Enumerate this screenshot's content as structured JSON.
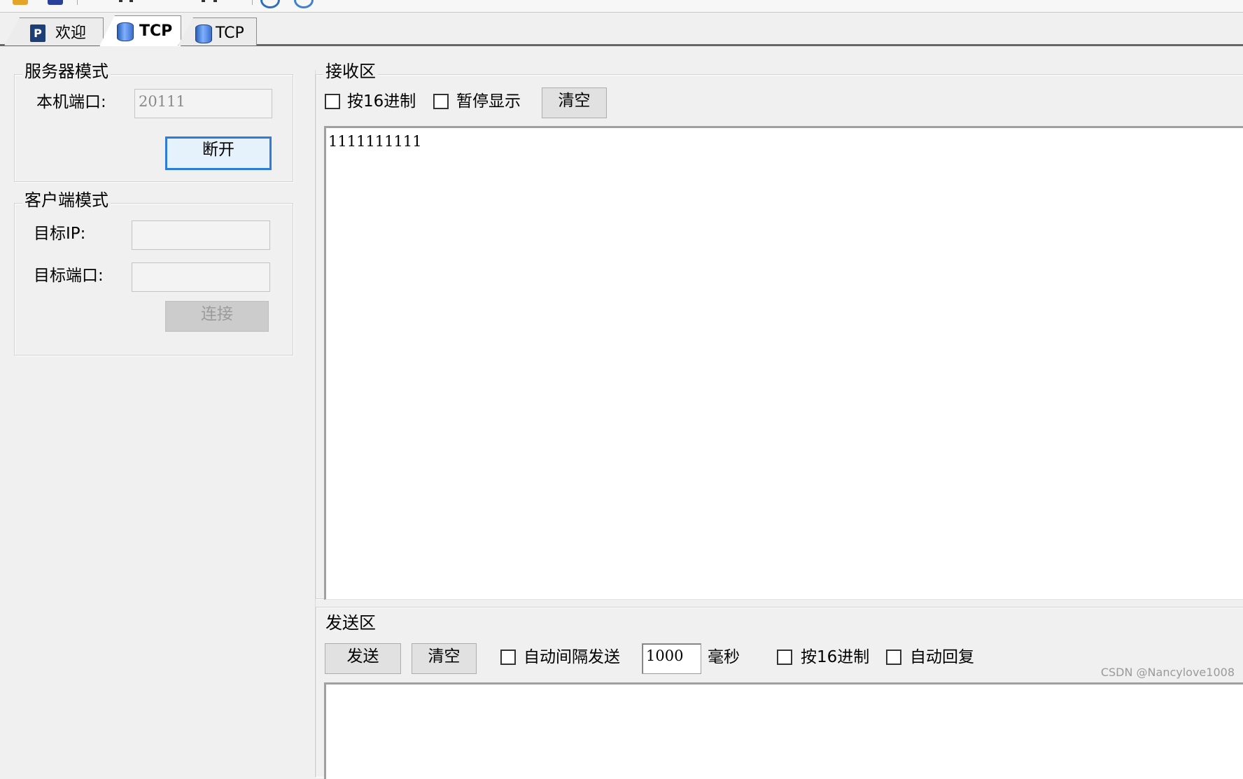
{
  "tabs": [
    {
      "label": "欢迎",
      "icon": "welcome-icon"
    },
    {
      "label": "TCP",
      "icon": "database-icon",
      "active": true
    },
    {
      "label": "TCP",
      "icon": "database-icon"
    }
  ],
  "server_mode": {
    "title": "服务器模式",
    "local_port_label": "本机端口:",
    "local_port_value": "20111",
    "disconnect_label": "断开"
  },
  "client_mode": {
    "title": "客户端模式",
    "target_ip_label": "目标IP:",
    "target_ip_value": "",
    "target_port_label": "目标端口:",
    "target_port_value": "",
    "connect_label": "连接"
  },
  "receive_area": {
    "title": "接收区",
    "hex_label": "按16进制",
    "pause_label": "暂停显示",
    "clear_label": "清空",
    "content": "1111111111"
  },
  "send_area": {
    "title": "发送区",
    "send_label": "发送",
    "clear_label": "清空",
    "auto_interval_label": "自动间隔发送",
    "interval_value": "1000",
    "ms_label": "毫秒",
    "hex_label": "按16进制",
    "auto_reply_label": "自动回复",
    "content": ""
  },
  "watermark": "CSDN @Nancylove1008",
  "colors": {
    "focus_blue": "#2f7bd9",
    "tab_border": "#8c8c8c",
    "panel_bg": "#f0f0f0"
  }
}
